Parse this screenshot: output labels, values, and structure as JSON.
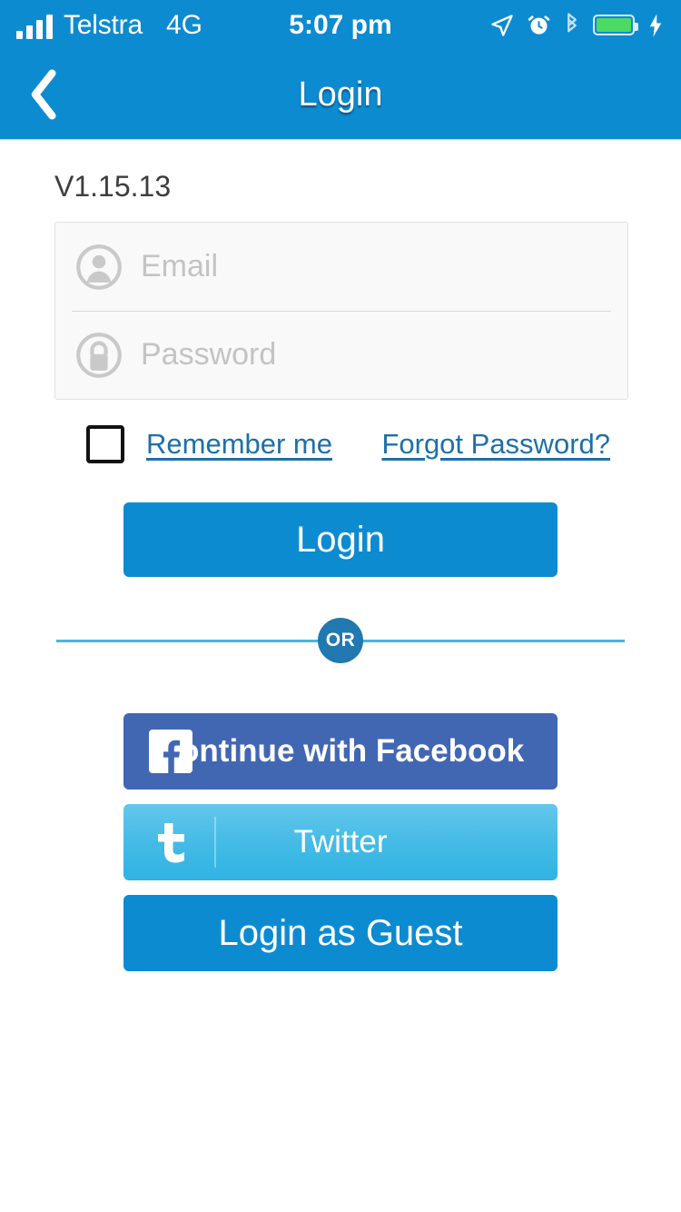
{
  "status_bar": {
    "carrier": "Telstra",
    "network": "4G",
    "time": "5:07 pm",
    "icons": [
      "signal-bars-icon",
      "location-arrow-icon",
      "alarm-clock-icon",
      "bluetooth-icon",
      "battery-icon",
      "charging-bolt-icon"
    ],
    "battery_color": "#4cd964"
  },
  "nav": {
    "title": "Login",
    "back_icon": "chevron-left-icon"
  },
  "theme": {
    "primary": "#0d8bd1",
    "link": "#1f6fa8",
    "divider_line": "#4db3e0",
    "or_badge": "#2278b0",
    "facebook": "#4267b2",
    "twitter": "#45bbe6"
  },
  "main": {
    "version": "V1.15.13",
    "fields": [
      {
        "name": "email",
        "placeholder": "Email",
        "value": "",
        "icon": "user-circle-icon"
      },
      {
        "name": "password",
        "placeholder": "Password",
        "value": "",
        "icon": "lock-circle-icon"
      }
    ],
    "remember_me": {
      "label": "Remember me",
      "checked": false
    },
    "forgot_password": "Forgot Password?",
    "login_button": "Login",
    "divider_label": "OR",
    "facebook_button": "Continue with Facebook",
    "twitter_button": "Twitter",
    "guest_button": "Login as Guest"
  }
}
